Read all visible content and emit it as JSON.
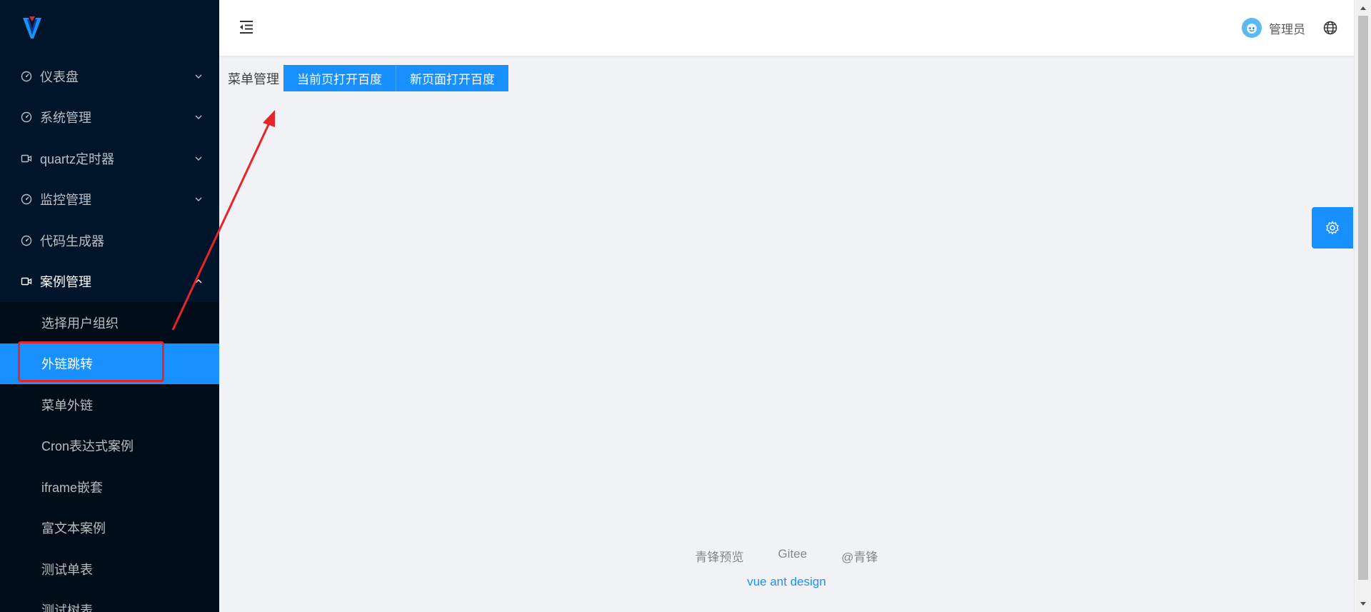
{
  "sidebar": {
    "logo": "vue-logo",
    "menu": [
      {
        "label": "仪表盘",
        "icon": "dashboard-icon"
      },
      {
        "label": "系统管理",
        "icon": "dashboard-icon"
      },
      {
        "label": "quartz定时器",
        "icon": "video-camera-icon"
      },
      {
        "label": "监控管理",
        "icon": "dashboard-icon"
      },
      {
        "label": "代码生成器",
        "icon": "dashboard-icon"
      },
      {
        "label": "案例管理",
        "icon": "video-camera-icon"
      }
    ],
    "submenu": [
      {
        "label": "选择用户组织"
      },
      {
        "label": "外链跳转"
      },
      {
        "label": "菜单外链"
      },
      {
        "label": "Cron表达式案例"
      },
      {
        "label": "iframe嵌套"
      },
      {
        "label": "富文本案例"
      },
      {
        "label": "测试单表"
      },
      {
        "label": "测试树表"
      }
    ]
  },
  "header": {
    "user_name": "管理员"
  },
  "content": {
    "toolbar_label": "菜单管理",
    "btn_current_page": "当前页打开百度",
    "btn_new_page": "新页面打开百度"
  },
  "footer": {
    "links": [
      "青锋预览",
      "Gitee",
      "@青锋"
    ],
    "copy": "vue ant design"
  },
  "colors": {
    "sidebar_bg": "#001529",
    "primary": "#1890ff",
    "annotation": "#e8242b"
  }
}
